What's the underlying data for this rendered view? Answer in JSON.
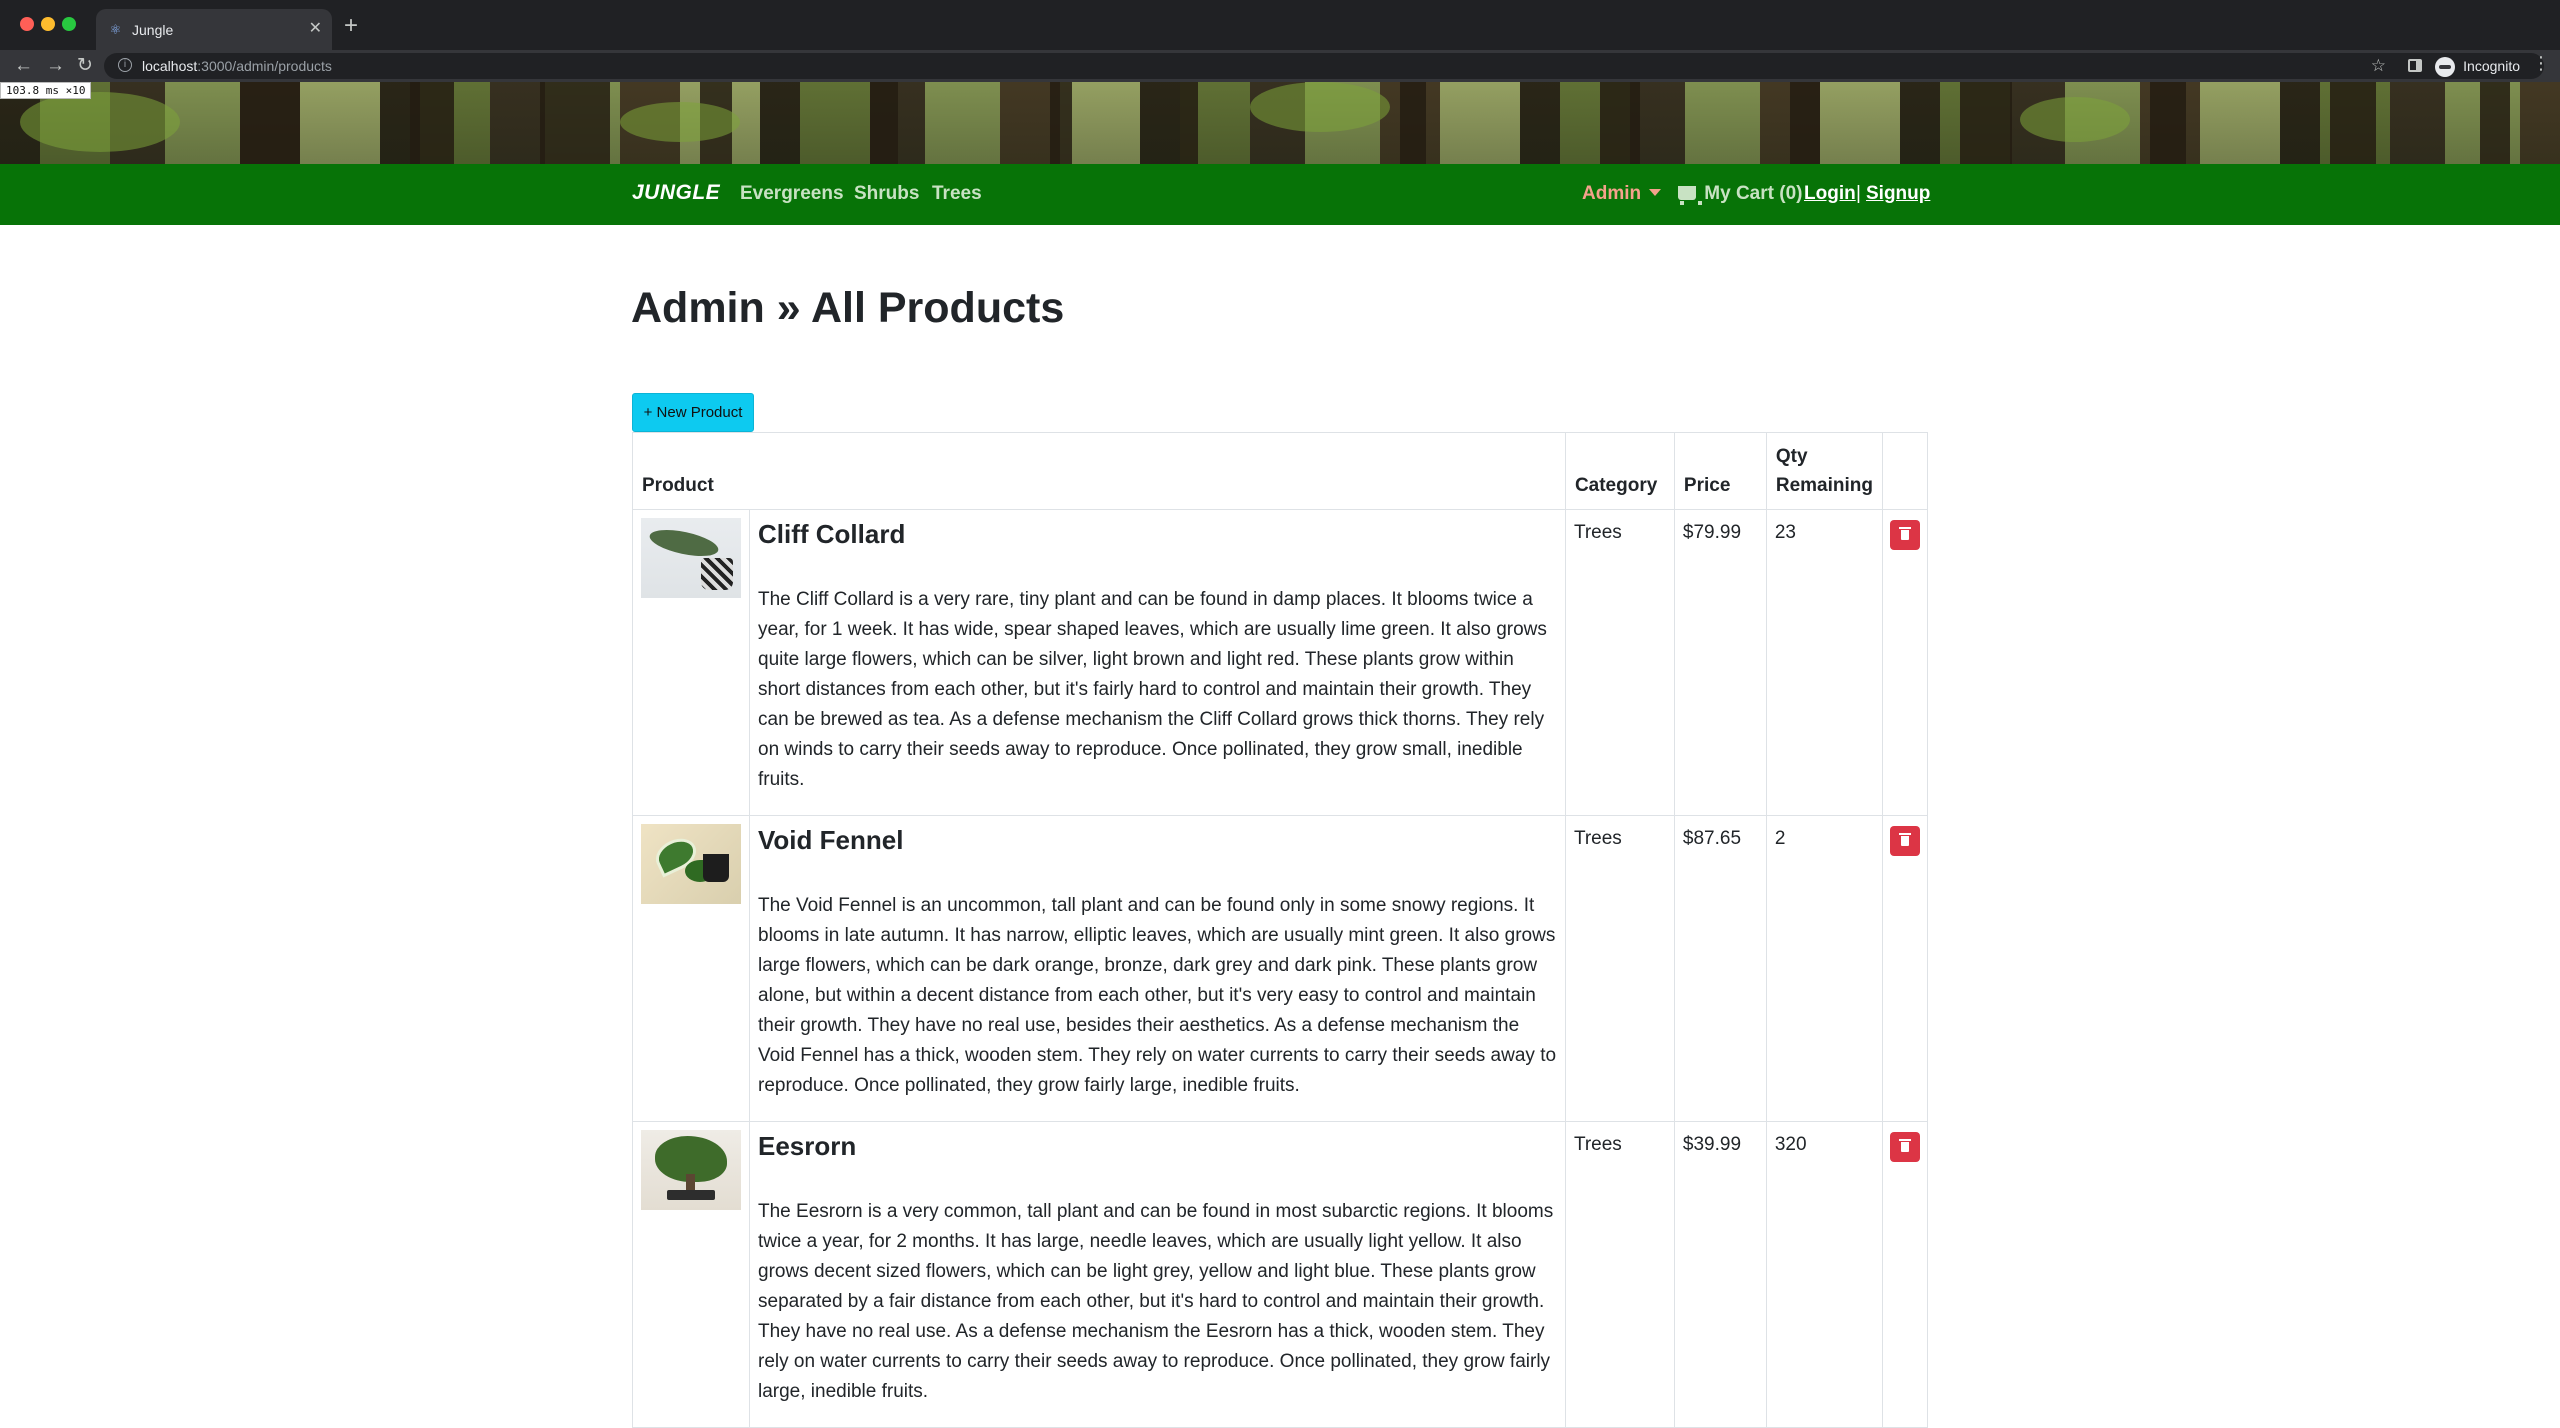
{
  "browser": {
    "tab_title": "Jungle",
    "tab_favicon": "react-icon",
    "url_host": "localhost",
    "url_path": ":3000/admin/products",
    "profile_label": "Incognito",
    "perf_overlay": "103.8 ms ×10"
  },
  "navbar": {
    "brand": "JUNGLE",
    "links": [
      "Evergreens",
      "Shrubs",
      "Trees"
    ],
    "admin_label": "Admin",
    "cart_label": "My Cart (0)",
    "login_label": "Login",
    "separator": "|",
    "signup_label": "Signup",
    "colors": {
      "bar": "#077307",
      "admin": "#f4a28c"
    }
  },
  "page": {
    "title": "Admin » All Products",
    "new_button_label": "+ New Product",
    "new_button_color": "#0dcaf0"
  },
  "table": {
    "headers": {
      "product": "Product",
      "category": "Category",
      "price": "Price",
      "qty": "Qty Remaining"
    },
    "rows": [
      {
        "name": "Cliff Collard",
        "description": "The Cliff Collard is a very rare, tiny plant and can be found in damp places. It blooms twice a year, for 1 week. It has wide, spear shaped leaves, which are usually lime green. It also grows quite large flowers, which can be silver, light brown and light red. These plants grow within short distances from each other, but it's fairly hard to control and maintain their growth. They can be brewed as tea. As a defense mechanism the Cliff Collard grows thick thorns. They rely on winds to carry their seeds away to reproduce. Once pollinated, they grow small, inedible fruits.",
        "category": "Trees",
        "price": "$79.99",
        "qty": "23"
      },
      {
        "name": "Void Fennel",
        "description": "The Void Fennel is an uncommon, tall plant and can be found only in some snowy regions. It blooms in late autumn. It has narrow, elliptic leaves, which are usually mint green. It also grows large flowers, which can be dark orange, bronze, dark grey and dark pink. These plants grow alone, but within a decent distance from each other, but it's very easy to control and maintain their growth. They have no real use, besides their aesthetics. As a defense mechanism the Void Fennel has a thick, wooden stem. They rely on water currents to carry their seeds away to reproduce. Once pollinated, they grow fairly large, inedible fruits.",
        "category": "Trees",
        "price": "$87.65",
        "qty": "2"
      },
      {
        "name": "Eesrorn",
        "description": "The Eesrorn is a very common, tall plant and can be found in most subarctic regions. It blooms twice a year, for 2 months. It has large, needle leaves, which are usually light yellow. It also grows decent sized flowers, which can be light grey, yellow and light blue. These plants grow separated by a fair distance from each other, but it's hard to control and maintain their growth. They have no real use. As a defense mechanism the Eesrorn has a thick, wooden stem. They rely on water currents to carry their seeds away to reproduce. Once pollinated, they grow fairly large, inedible fruits.",
        "category": "Trees",
        "price": "$39.99",
        "qty": "320"
      }
    ],
    "delete_icon": "trash-icon",
    "delete_color": "#dc3545"
  }
}
